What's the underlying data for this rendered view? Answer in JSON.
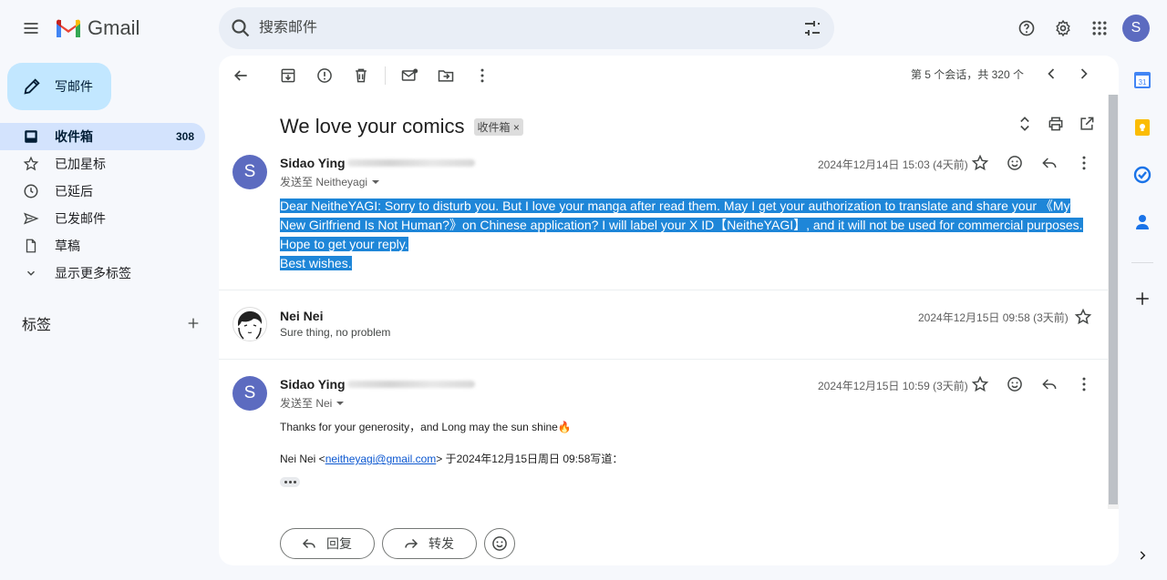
{
  "header": {
    "app_name": "Gmail",
    "search_placeholder": "搜索邮件",
    "avatar_letter": "S"
  },
  "sidebar": {
    "compose_label": "写邮件",
    "items": [
      {
        "label": "收件箱",
        "count": "308"
      },
      {
        "label": "已加星标"
      },
      {
        "label": "已延后"
      },
      {
        "label": "已发邮件"
      },
      {
        "label": "草稿"
      },
      {
        "label": "显示更多标签"
      }
    ],
    "labels_title": "标签"
  },
  "toolbar": {
    "pager_text": "第 5 个会话，共 320 个"
  },
  "thread": {
    "subject": "We love your comics",
    "tag": "收件箱 ×",
    "messages": [
      {
        "avatar": "S",
        "sender": "Sidao Ying",
        "to": "发送至 Neitheyagi",
        "date": "2024年12月14日 15:03 (4天前)",
        "body": [
          "Dear NeitheYAGI: Sorry to disturb you. But I love your manga after read them. May I get your authorization to translate and share your 《My",
          "New Girlfriend Is Not Human?》on Chinese application? I will label your X ID【NeitheYAGI】, and it will not be used for commercial purposes.",
          "Hope to get your reply.",
          "Best wishes."
        ]
      },
      {
        "sender": "Nei Nei",
        "snippet": "Sure thing, no problem",
        "date": "2024年12月15日 09:58 (3天前)"
      },
      {
        "avatar": "S",
        "sender": "Sidao Ying",
        "to": "发送至 Nei",
        "date": "2024年12月15日 10:59 (3天前)",
        "body_line": "Thanks for your generosity，and Long may the sun shine🔥",
        "quote_prefix": "Nei Nei <",
        "quote_email": "neitheyagi@gmail.com",
        "quote_suffix": "> 于2024年12月15日周日 09:58写道："
      }
    ],
    "reply_label": "回复",
    "forward_label": "转发"
  },
  "colors": {
    "compose_bg": "#c2e7ff",
    "active_nav": "#d3e3fd",
    "selection": "#1e86d8",
    "avatar": "#5c6bc0"
  }
}
